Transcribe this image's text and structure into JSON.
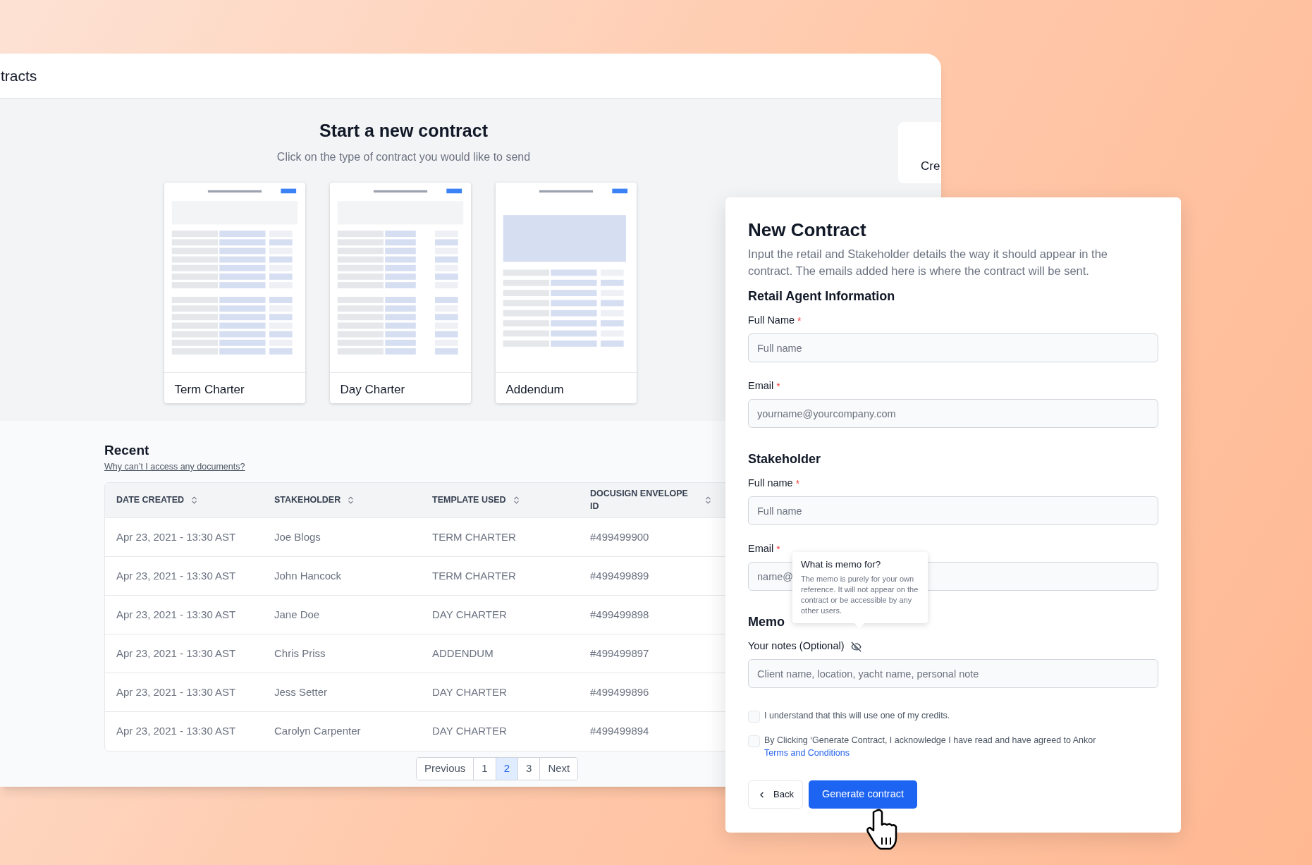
{
  "back_window": {
    "title": "tracts"
  },
  "new_contract": {
    "heading": "Start a new contract",
    "subtitle": "Click on the type of contract you would like to send",
    "templates": [
      {
        "label": "Term Charter"
      },
      {
        "label": "Day Charter"
      },
      {
        "label": "Addendum"
      }
    ]
  },
  "side_card": {
    "text": "Cre"
  },
  "recent": {
    "heading": "Recent",
    "help_link": "Why can’t I access any documents?",
    "table": {
      "columns": [
        "DATE CREATED",
        "STAKEHOLDER",
        "TEMPLATE USED",
        "DOCUSIGN ENVELOPE ID"
      ],
      "rows": [
        [
          "Apr 23, 2021 - 13:30 AST",
          "Joe Blogs",
          "TERM CHARTER",
          "#499499900"
        ],
        [
          "Apr 23, 2021 - 13:30 AST",
          "John Hancock",
          "TERM CHARTER",
          "#499499899"
        ],
        [
          "Apr 23, 2021 - 13:30 AST",
          "Jane Doe",
          "DAY CHARTER",
          "#499499898"
        ],
        [
          "Apr 23, 2021 - 13:30 AST",
          "Chris Priss",
          "ADDENDUM",
          "#499499897"
        ],
        [
          "Apr 23, 2021 - 13:30 AST",
          "Jess Setter",
          "DAY CHARTER",
          "#499499896"
        ],
        [
          "Apr 23, 2021 - 13:30 AST",
          "Carolyn Carpenter",
          "DAY CHARTER",
          "#499499894"
        ]
      ]
    },
    "pagination": [
      {
        "label": "Previous",
        "selected": false
      },
      {
        "label": "1",
        "selected": false
      },
      {
        "label": "2",
        "selected": true
      },
      {
        "label": "3",
        "selected": false
      },
      {
        "label": "Next",
        "selected": false
      }
    ]
  },
  "form": {
    "title": "New Contract",
    "description": "Input the retail and Stakeholder details the way it should appear in the contract. The emails added here is where the contract will be sent.",
    "sections": [
      {
        "heading": "Retail Agent Information",
        "fields": [
          {
            "label": "Full Name",
            "required_mark": "*",
            "placeholder": "Full name",
            "hint_icon": false
          },
          {
            "label": "Email",
            "required_mark": "*",
            "placeholder": "yourname@yourcompany.com",
            "hint_icon": false
          }
        ]
      },
      {
        "heading": "Stakeholder",
        "fields": [
          {
            "label": "Full name",
            "required_mark": "*",
            "placeholder": "Full name",
            "hint_icon": false
          },
          {
            "label": "Email",
            "required_mark": "*",
            "placeholder": "name@",
            "hint_icon": false
          }
        ]
      },
      {
        "heading": "Memo",
        "fields": [
          {
            "label": "Your notes (Optional)",
            "placeholder": "Client name, location, yacht name, personal note",
            "hint_icon": true
          }
        ]
      }
    ],
    "checkboxes": [
      {
        "text": "I understand that this will use one of my credits.",
        "checked": false
      },
      {
        "text": "By Clicking ‘Generate Contract, I acknowledge I have read and have agreed to Ankor",
        "link": "Terms and Conditions",
        "checked": false
      }
    ],
    "back_button": "Back",
    "submit_button": "Generate contract",
    "tooltip": {
      "title": "What is memo for?",
      "body": "The memo is purely for your own reference. It will not appear on the contract or be accessible by any other users."
    }
  }
}
